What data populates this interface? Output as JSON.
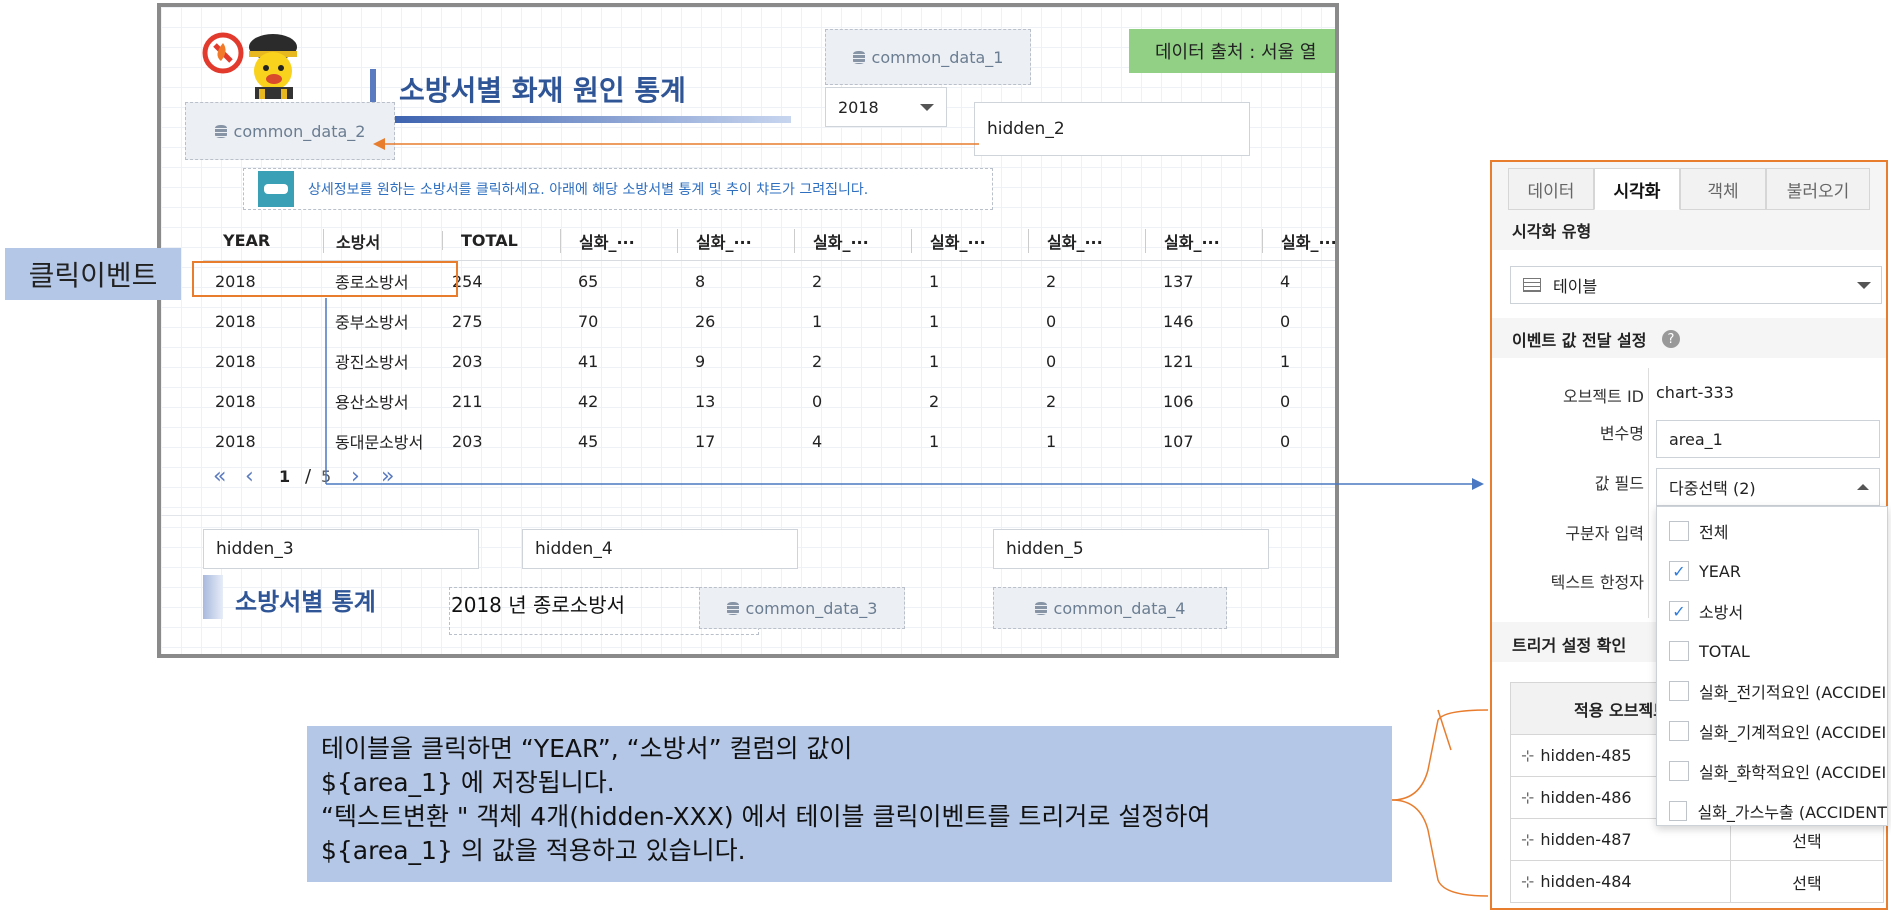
{
  "canvas": {
    "data_source_label": "데이터 출처 : 서울 열",
    "title": "소방서별 화재 원인 통계",
    "common_data_1": "common_data_1",
    "common_data_2": "common_data_2",
    "common_data_3": "common_data_3",
    "common_data_4": "common_data_4",
    "year_select": "2018",
    "hidden_2": "hidden_2",
    "hidden_3": "hidden_3",
    "hidden_4": "hidden_4",
    "hidden_5": "hidden_5",
    "instruction": "상세정보를 원하는 소방서를 클릭하세요. 아래에 해당 소방서별 통계 및 추이  챠트가 그려집니다.",
    "section_title": "소방서별 통계",
    "selected_text": "2018 년 종로소방서",
    "table": {
      "headers": [
        "YEAR",
        "소방서",
        "TOTAL",
        "실화_···",
        "실화_···",
        "실화_···",
        "실화_···",
        "실화_···",
        "실화_···",
        "실화_···"
      ],
      "rows": [
        [
          "2018",
          "종로소방서",
          "254",
          "65",
          "8",
          "2",
          "1",
          "2",
          "137",
          "4"
        ],
        [
          "2018",
          "중부소방서",
          "275",
          "70",
          "26",
          "1",
          "1",
          "0",
          "146",
          "0"
        ],
        [
          "2018",
          "광진소방서",
          "203",
          "41",
          "9",
          "2",
          "1",
          "0",
          "121",
          "1"
        ],
        [
          "2018",
          "용산소방서",
          "211",
          "42",
          "13",
          "0",
          "2",
          "2",
          "106",
          "0"
        ],
        [
          "2018",
          "동대문소방서",
          "203",
          "45",
          "17",
          "4",
          "1",
          "1",
          "107",
          "0"
        ]
      ]
    },
    "pagination": {
      "first": "«",
      "prev": "‹",
      "current": "1",
      "sep": "/",
      "total": "5",
      "next": "›",
      "last": "»"
    }
  },
  "callout_left": "클릭이벤트",
  "note_lines": [
    "테이블을 클릭하면 “YEAR”, “소방서” 컬럼의 값이",
    "${area_1} 에 저장됩니다.",
    "“텍스트변환 \"  객체 4개(hidden-XXX) 에서 테이블 클릭이벤트를 트리거로 설정하여",
    " ${area_1} 의 값을 적용하고 있습니다."
  ],
  "panel": {
    "tabs": [
      "데이터",
      "시각화",
      "객체",
      "불러오기"
    ],
    "active_tab": "시각화",
    "viz_type_label": "시각화 유형",
    "viz_type_value": "테이블",
    "event_section": "이벤트 값 전달 설정",
    "object_id_label": "오브젝트 ID",
    "object_id_value": "chart-333",
    "var_label": "변수명",
    "var_value": "area_1",
    "value_field_label": "값 필드",
    "value_field_value": "다중선택 (2)",
    "separator_label": "구분자 입력",
    "text_limiter_label": "텍스트 한정자",
    "trigger_section": "트리거 설정 확인",
    "apply_object_header": "적용 오브젝트",
    "dropdown_options": [
      {
        "label": "전체",
        "checked": false
      },
      {
        "label": "YEAR",
        "checked": true
      },
      {
        "label": "소방서",
        "checked": true
      },
      {
        "label": "TOTAL",
        "checked": false
      },
      {
        "label": "실화_전기적요인 (ACCIDEI",
        "checked": false
      },
      {
        "label": "실화_기계적요인 (ACCIDEI",
        "checked": false
      },
      {
        "label": "실화_화학적요인 (ACCIDEI",
        "checked": false
      },
      {
        "label": "실화_가스누출 (ACCIDENT",
        "checked": false
      }
    ],
    "trigger_rows": [
      {
        "name": "hidden-485",
        "action": ""
      },
      {
        "name": "hidden-486",
        "action": ""
      },
      {
        "name": "hidden-487",
        "action": "선택"
      },
      {
        "name": "hidden-484",
        "action": "선택"
      }
    ]
  },
  "colors": {
    "accent_orange": "#e87d2e",
    "title_blue": "#2f5597",
    "note_bg": "#b4c7e7",
    "green": "#92d086"
  }
}
